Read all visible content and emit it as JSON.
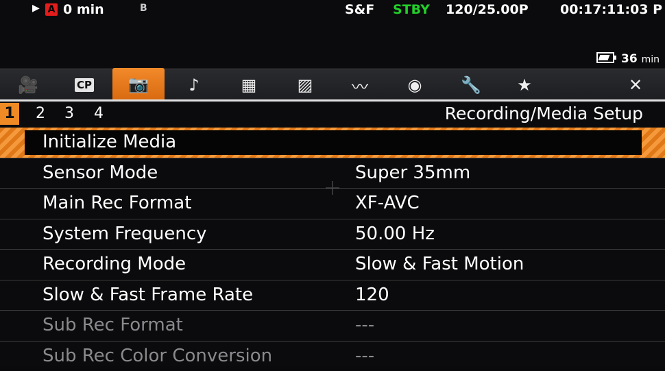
{
  "status_bar": {
    "play_icon": "▶",
    "media_badge": "A",
    "remaining_time": "0 min",
    "bi_icon": "B",
    "sf_label": "S&F",
    "stby_label": "STBY",
    "frame_rate": "120/25.00P",
    "timecode": "00:17:11:03 P",
    "stby_color": "#22d02a"
  },
  "battery": {
    "value": "36",
    "unit": "min"
  },
  "tabs": [
    {
      "icon": "camera-icon",
      "glyph": "🎥"
    },
    {
      "icon": "cp-icon",
      "glyph": "CP"
    },
    {
      "icon": "recording-media-setup-icon",
      "glyph": "📷"
    },
    {
      "icon": "audio-icon",
      "glyph": "♪"
    },
    {
      "icon": "monitoring-setup-icon",
      "glyph": "▦"
    },
    {
      "icon": "assistance-functions-icon",
      "glyph": "▨"
    },
    {
      "icon": "network-icon",
      "glyph": "〰"
    },
    {
      "icon": "system-setup-icon",
      "glyph": "◉"
    },
    {
      "icon": "wrench-icon",
      "glyph": "🔧"
    },
    {
      "icon": "my-menu-star-icon",
      "glyph": "★"
    },
    {
      "icon": "close-icon",
      "glyph": "✕"
    }
  ],
  "pages": [
    "1",
    "2",
    "3",
    "4"
  ],
  "section_title": "Recording/Media Setup",
  "accent_color": "#f08a24",
  "menu_items": [
    {
      "label": "Initialize Media",
      "value": ""
    },
    {
      "label": "Sensor Mode",
      "value": "Super 35mm"
    },
    {
      "label": "Main Rec Format",
      "value": "XF-AVC"
    },
    {
      "label": "System Frequency",
      "value": "50.00 Hz"
    },
    {
      "label": "Recording Mode",
      "value": "Slow & Fast Motion"
    },
    {
      "label": "Slow & Fast Frame Rate",
      "value": "120"
    },
    {
      "label": "Sub Rec Format",
      "value": "---"
    },
    {
      "label": "Sub Rec Color Conversion",
      "value": "---"
    }
  ]
}
